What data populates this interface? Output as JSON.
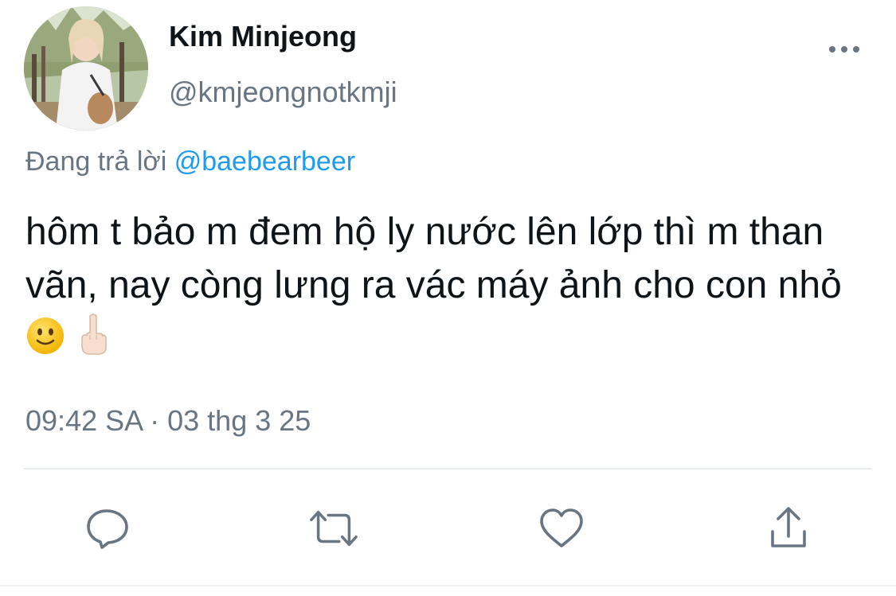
{
  "author": {
    "display_name": "Kim Minjeong",
    "handle": "@kmjeongnotkmji"
  },
  "reply": {
    "prefix": "Đang trả lời",
    "mention": "@baebearbeer"
  },
  "tweet": {
    "text": "hôm t bảo m đem hộ ly nước lên lớp thì m than vãn, nay còng lưng ra vác máy ảnh cho con nhỏ",
    "emojis": [
      "slightly-smiling-face",
      "middle-finger"
    ],
    "timestamp": "09:42 SA · 03 thg 3 25"
  },
  "actions": [
    {
      "name": "reply",
      "icon": "comment-icon"
    },
    {
      "name": "retweet",
      "icon": "retweet-icon"
    },
    {
      "name": "like",
      "icon": "heart-icon"
    },
    {
      "name": "share",
      "icon": "share-icon"
    }
  ],
  "colors": {
    "text": "#0f1419",
    "secondary": "#687684",
    "link": "#1d9bf0",
    "divider": "#e6ecf0"
  }
}
